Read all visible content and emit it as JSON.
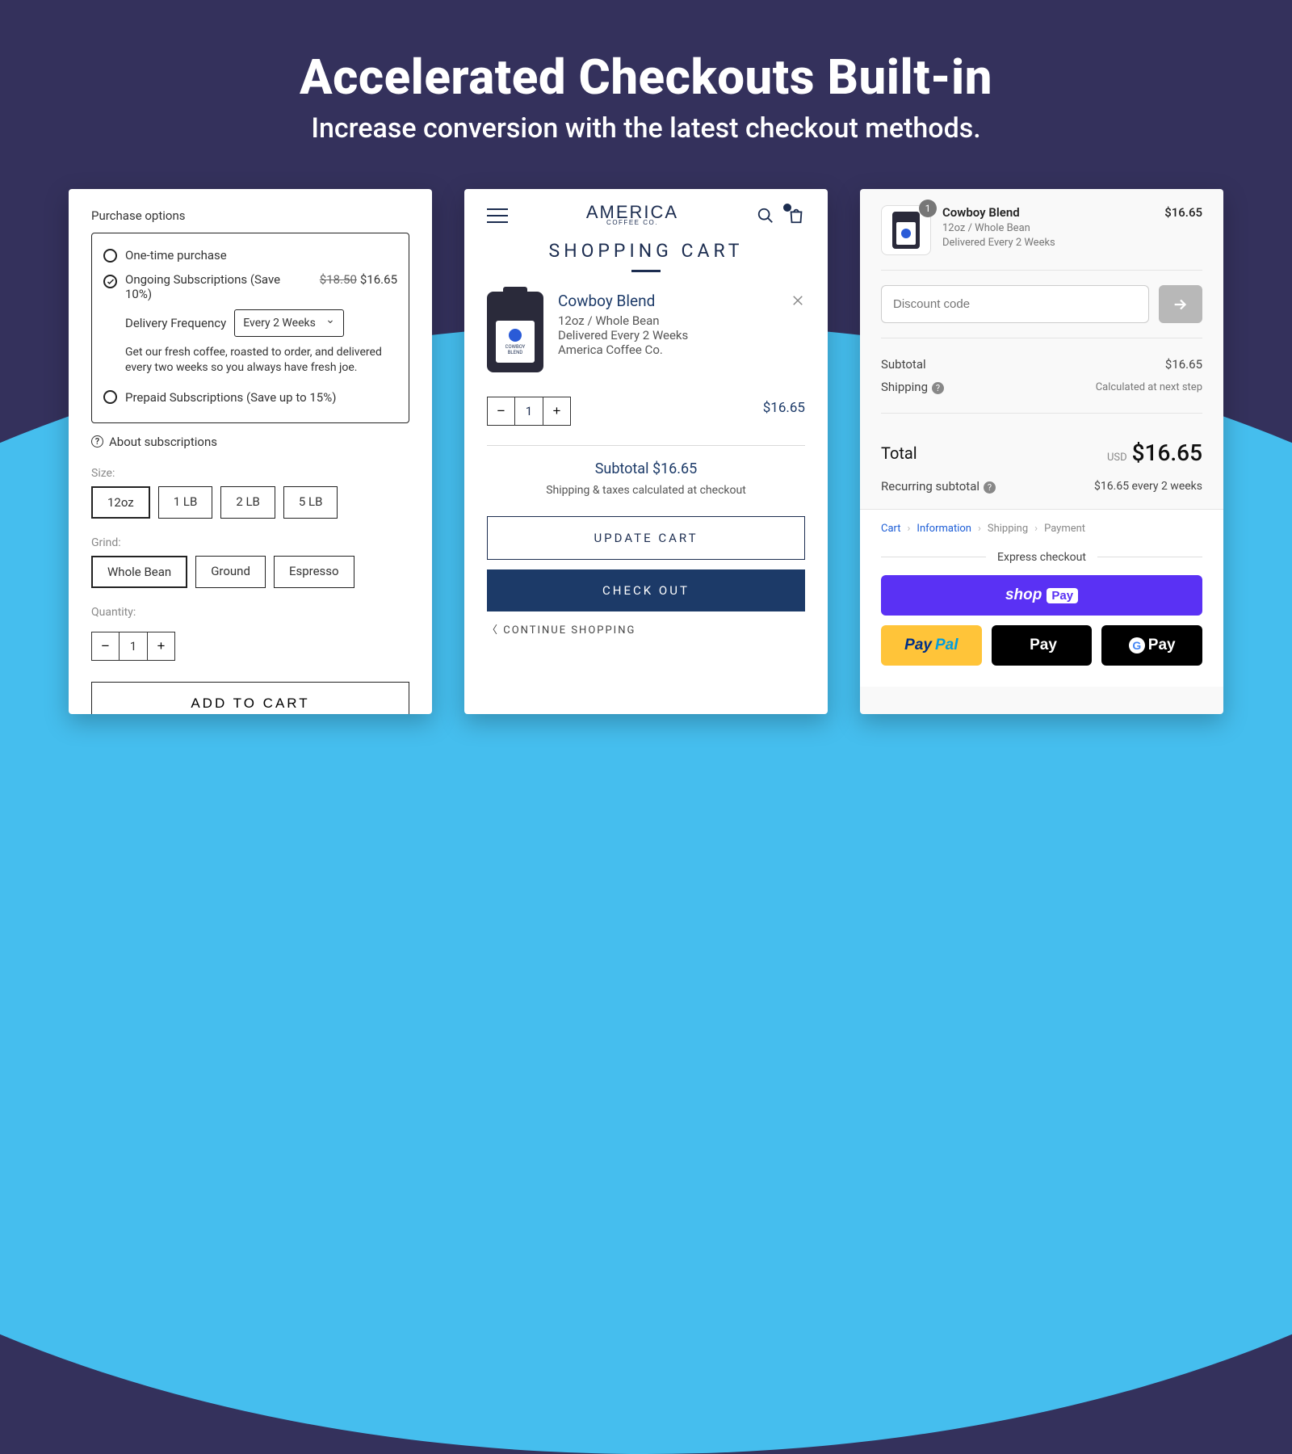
{
  "hero": {
    "title": "Accelerated Checkouts Built-in",
    "subtitle": "Increase conversion with the latest checkout methods."
  },
  "panel1": {
    "purchase_options_title": "Purchase options",
    "one_time": "One-time purchase",
    "ongoing": "Ongoing Subscriptions (Save 10%)",
    "old_price": "$18.50",
    "new_price": "$16.65",
    "freq_label": "Delivery Frequency",
    "freq_value": "Every 2 Weeks",
    "help": "Get our fresh coffee, roasted to order, and delivered every two weeks so you always have fresh joe.",
    "prepaid": "Prepaid Subscriptions (Save up to 15%)",
    "about": "About subscriptions",
    "size_label": "Size:",
    "sizes": [
      "12oz",
      "1 LB",
      "2 LB",
      "5 LB"
    ],
    "grind_label": "Grind:",
    "grinds": [
      "Whole Bean",
      "Ground",
      "Espresso"
    ],
    "qty_label": "Quantity:",
    "qty": "1",
    "add": "ADD TO CART"
  },
  "panel2": {
    "logo_top": "AMERICA",
    "logo_sub": "COFFEE CO.",
    "title": "SHOPPING CART",
    "product_name": "Cowboy Blend",
    "variant": "12oz / Whole Bean",
    "delivery": "Delivered Every 2 Weeks",
    "brand": "America Coffee Co.",
    "qty": "1",
    "price": "$16.65",
    "subtotal_label": "Subtotal",
    "subtotal": "$16.65",
    "tax_note": "Shipping & taxes calculated at checkout",
    "update": "UPDATE CART",
    "checkout": "CHECK OUT",
    "continue": "CONTINUE SHOPPING"
  },
  "panel3": {
    "badge": "1",
    "name": "Cowboy Blend",
    "variant": "12oz / Whole Bean",
    "delivery": "Delivered Every 2 Weeks",
    "price": "$16.65",
    "discount_placeholder": "Discount code",
    "subtotal_label": "Subtotal",
    "subtotal": "$16.65",
    "shipping_label": "Shipping",
    "shipping_value": "Calculated at next step",
    "total_label": "Total",
    "currency": "USD",
    "total": "$16.65",
    "recurring_label": "Recurring subtotal",
    "recurring_value": "$16.65 every 2 weeks",
    "crumbs": {
      "cart": "Cart",
      "info": "Information",
      "ship": "Shipping",
      "pay": "Payment"
    },
    "express_label": "Express checkout",
    "shop_pay": "shop",
    "pay_pill": "Pay",
    "paypal_pay": "Pay",
    "paypal_pal": "Pal",
    "apple_pay": "Pay",
    "g_pay": "Pay"
  }
}
